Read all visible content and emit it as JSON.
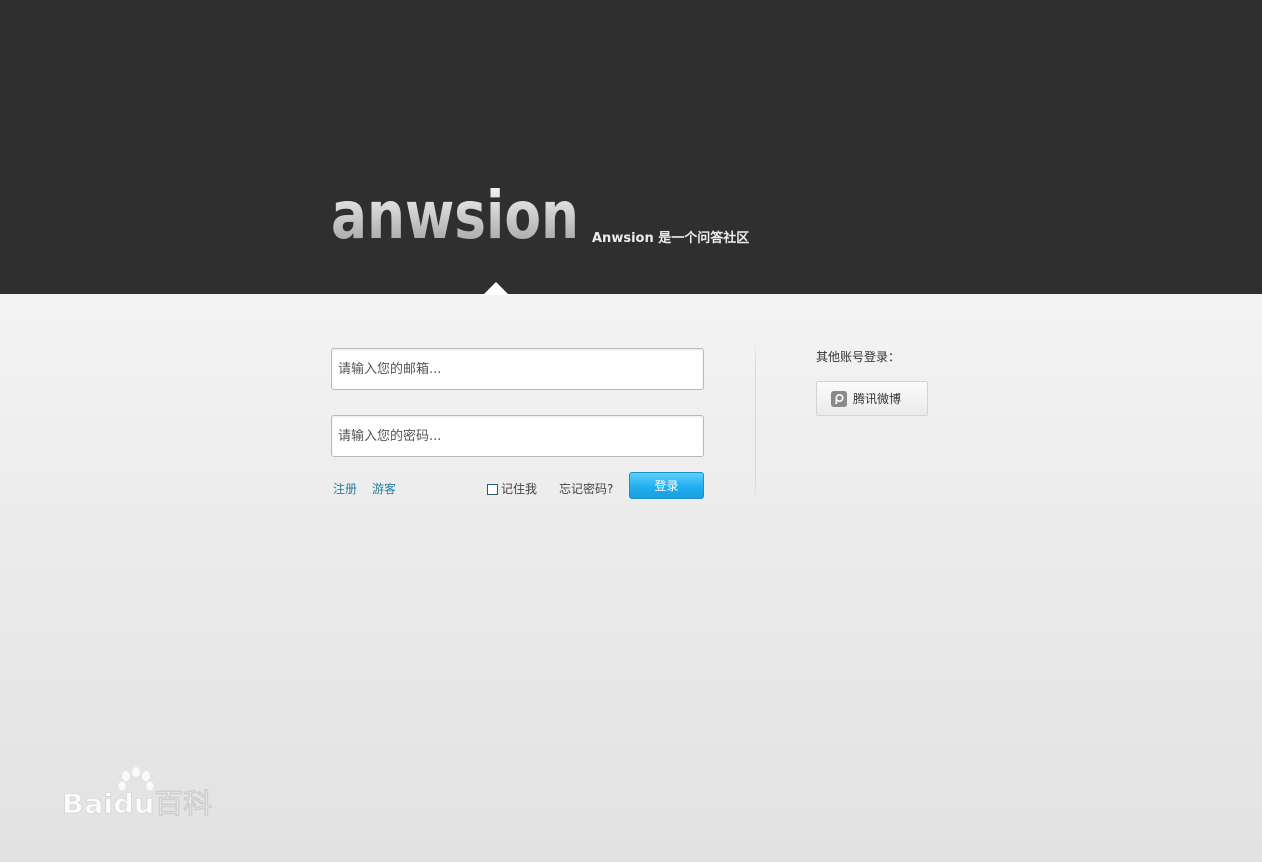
{
  "header": {
    "logo_text": "anwsion",
    "tagline": "Anwsion 是一个问答社区"
  },
  "login_form": {
    "email_placeholder": "请输入您的邮箱...",
    "password_placeholder": "请输入您的密码...",
    "register_link": "注册",
    "guest_link": "游客",
    "remember_label": "记住我",
    "forgot_password": "忘记密码?",
    "login_button": "登录"
  },
  "other_login": {
    "title": "其他账号登录：",
    "tencent_weibo": "腾讯微博"
  },
  "watermark": {
    "text": "Baidu百科"
  },
  "colors": {
    "header_bg": "#2f2f2f",
    "link": "#2a7fa0",
    "login_button": "#22aef0"
  }
}
